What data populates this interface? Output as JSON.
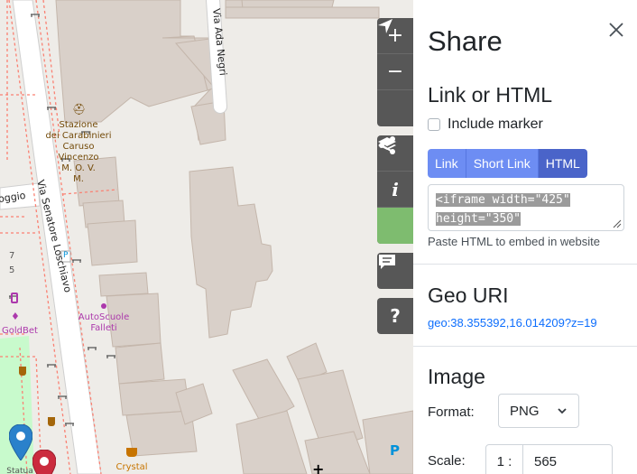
{
  "map": {
    "street_labels": {
      "ada_negri": "Via Ada Negri",
      "loschiavo": "Via Senatore Loschiavo",
      "oggio": "oggio"
    },
    "poi": {
      "carabinieri": "Stazione\ndei Carabinieri\nCaruso\nVincenzo\nM. O. V.\nM.",
      "autoscuole": "AutoScuole\nFalleti",
      "goldbet": "GoldBet",
      "crystal": "Crystal",
      "statua": "Statua"
    },
    "house_numbers": [
      "7",
      "5"
    ],
    "parking_label": "P",
    "controls": {
      "zoom_in": "+",
      "zoom_out": "−",
      "info": "i",
      "help": "?"
    }
  },
  "share": {
    "title": "Share",
    "link_section": {
      "heading": "Link or HTML",
      "include_marker_label": "Include marker",
      "include_marker_checked": false,
      "tabs": [
        "Link",
        "Short Link",
        "HTML"
      ],
      "active_tab": "HTML",
      "code_line1": "<iframe width=\"425\"",
      "code_line2": "height=\"350\"",
      "help": "Paste HTML to embed in website"
    },
    "geo_section": {
      "heading": "Geo URI",
      "uri": "geo:38.355392,16.014209?z=19"
    },
    "image_section": {
      "heading": "Image",
      "format_label": "Format:",
      "format_value": "PNG",
      "scale_label": "Scale:",
      "scale_prefix": "1 :",
      "scale_value": "565"
    }
  },
  "colors": {
    "osm_green": "#7ebc6f",
    "control_bg": "#575757",
    "building": "#d9d0c9",
    "link_blue": "#0d6efd",
    "tab_blue": "#6d8df3"
  }
}
